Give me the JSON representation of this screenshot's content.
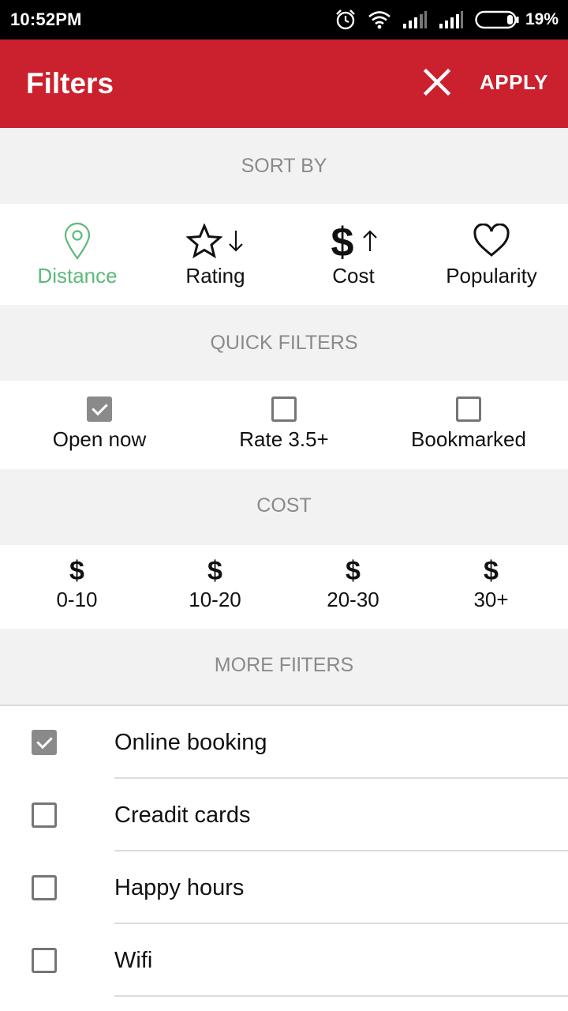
{
  "status_bar": {
    "time": "10:52PM",
    "battery": "19%"
  },
  "app_bar": {
    "title": "Filters",
    "apply_label": "APPLY"
  },
  "sections": {
    "sort_by": "SORT BY",
    "quick_filters": "QUICK FILTERS",
    "cost": "COST",
    "more_filters": "MORE FIlTERS"
  },
  "sort_options": [
    {
      "label": "Distance",
      "icon": "map-pin-icon",
      "active": true
    },
    {
      "label": "Rating",
      "icon": "star-down-icon",
      "active": false
    },
    {
      "label": "Cost",
      "icon": "dollar-up-icon",
      "active": false
    },
    {
      "label": "Popularity",
      "icon": "heart-icon",
      "active": false
    }
  ],
  "quick_filters": [
    {
      "label": "Open now",
      "checked": true
    },
    {
      "label": "Rate 3.5+",
      "checked": false
    },
    {
      "label": "Bookmarked",
      "checked": false
    }
  ],
  "cost_options": [
    {
      "symbol": "$",
      "label": "0-10"
    },
    {
      "symbol": "$",
      "label": "10-20"
    },
    {
      "symbol": "$",
      "label": "20-30"
    },
    {
      "symbol": "$",
      "label": "30+"
    }
  ],
  "more_filters": [
    {
      "label": "Online booking",
      "checked": true
    },
    {
      "label": "Creadit cards",
      "checked": false
    },
    {
      "label": "Happy hours",
      "checked": false
    },
    {
      "label": "Wifi",
      "checked": false
    }
  ],
  "colors": {
    "brand": "#cb202d",
    "active": "#5db97c",
    "section_bg": "#f2f2f2"
  }
}
